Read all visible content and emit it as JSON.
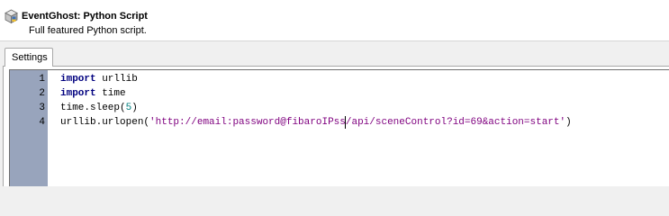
{
  "window": {
    "title": "EventGhost: Python Script",
    "description": "Full featured Python script.",
    "icon": "python-script-icon"
  },
  "tabs": [
    {
      "label": "Settings",
      "active": true
    }
  ],
  "editor": {
    "line_numbers": [
      "1",
      "2",
      "3",
      "4"
    ],
    "lines": [
      {
        "kw": "import",
        "rest": " urllib"
      },
      {
        "kw": "import",
        "rest": " time"
      },
      {
        "pre": "time.sleep(",
        "num": "5",
        "post": ")"
      },
      {
        "pre": "urllib.urlopen(",
        "str_a": "'http://email:password@fibaroIPss",
        "str_b": "/api/sceneControl?id=69&action=start'",
        "post": ")"
      }
    ],
    "colors": {
      "gutter": "#98a4bc",
      "keyword": "#00007f",
      "number": "#007f7f",
      "string": "#7f007f"
    }
  }
}
